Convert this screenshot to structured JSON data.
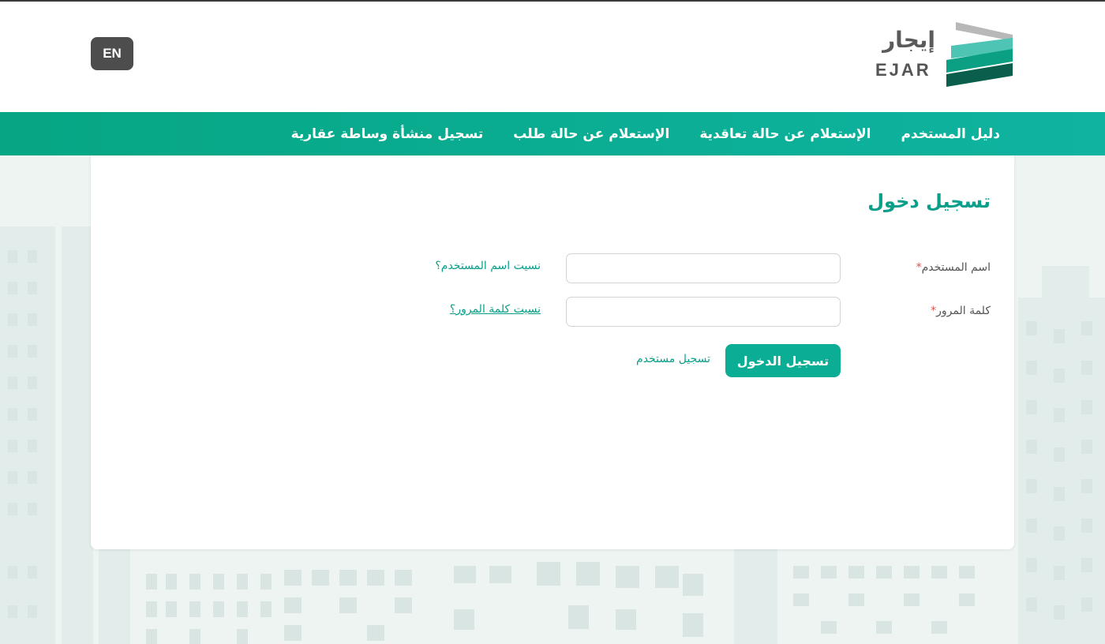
{
  "header": {
    "lang_button": "EN",
    "logo_ar": "إيجار",
    "logo_en": "EJAR"
  },
  "nav": {
    "items": [
      {
        "label": "تسجيل منشأة وساطة عقارية"
      },
      {
        "label": "الإستعلام عن حالة طلب"
      },
      {
        "label": "الإستعلام عن حالة تعاقدية"
      },
      {
        "label": "دليل المستخدم"
      }
    ]
  },
  "login": {
    "title": "تسجيل دخول",
    "username_label": "اسم المستخدم",
    "password_label": "كلمة المرور",
    "required_marker": "*",
    "username_value": "",
    "password_value": "",
    "forgot_username": "نسيت اسم المستخدم؟",
    "forgot_password": "نسيت كلمة المرور؟",
    "submit_label": "تسجيل الدخول",
    "register_label": "تسجيل مستخدم"
  },
  "colors": {
    "brand": "#0a9f8a",
    "nav_start": "#06a684",
    "nav_end": "#0fb3a0",
    "lang_button": "#4d4d4d"
  }
}
